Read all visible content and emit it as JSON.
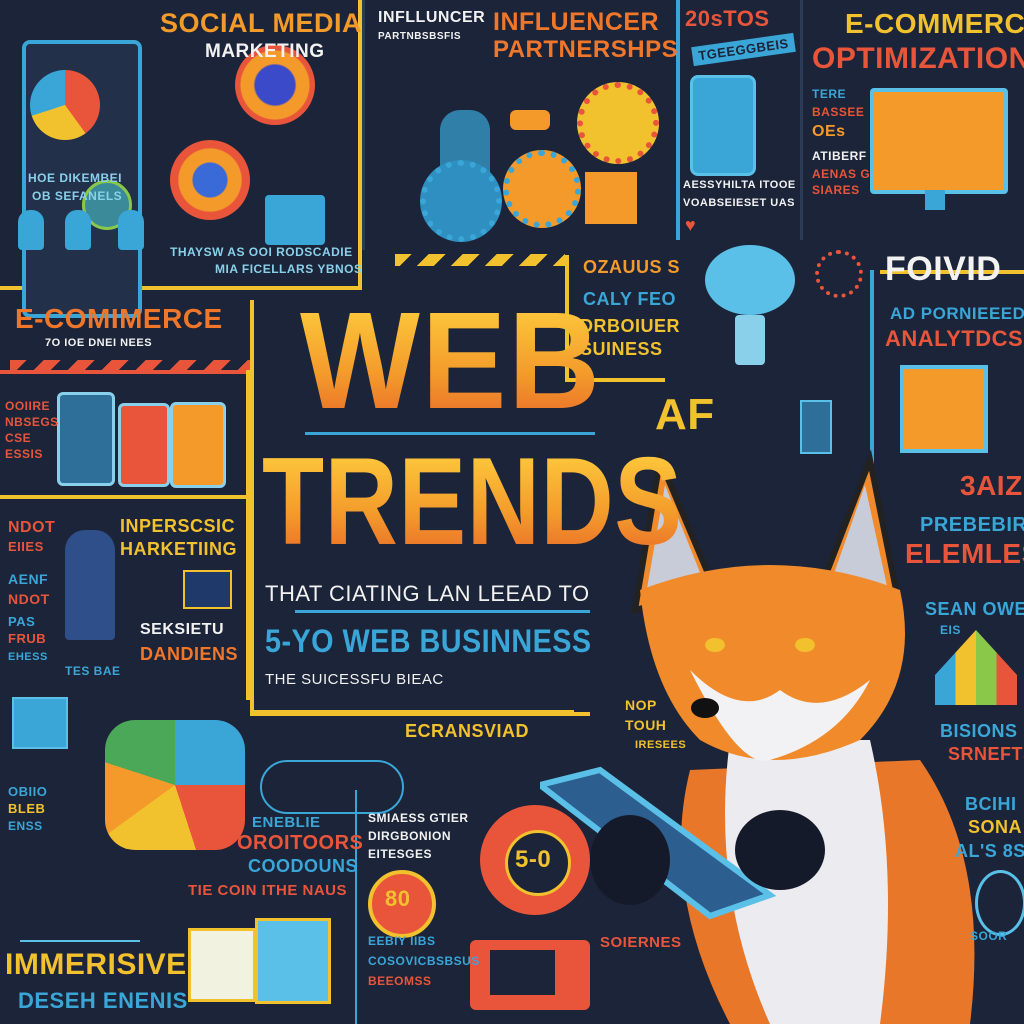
{
  "colors": {
    "background": "#1b2438",
    "yellow": "#f2c12e",
    "orange": "#f39a2b",
    "red": "#e8553a",
    "cyan": "#3aa6d8",
    "white": "#f2f2f2"
  },
  "social": {
    "title": "SOCIAL MEDIA",
    "subtitle": "MARKETING",
    "note1": "HOE DIKEMBEI",
    "note2": "OB SEFANELS",
    "caption1": "THAYSW AS OOI RODSCADIE",
    "caption2": "MIA FICELLARS YBNOS"
  },
  "influencer": {
    "small_title": "INFLLUNCER",
    "small_sub": "PARTNBSBSFIS",
    "title": "INFLUENCER",
    "subtitle": "PARTNERSHPS"
  },
  "stats": {
    "title": "20sTOS",
    "banner": "TGEEGGBEIS",
    "line1": "AESSYHILTA ITOOE",
    "line2": "VOABSEIESET UAS"
  },
  "ecom_opt": {
    "title1": "E-COMMERCE",
    "title2": "OPTIMIZATION",
    "side": [
      "TERE",
      "BASSEE",
      "OEs",
      "ATIBERF",
      "AENAS G",
      "SIARES"
    ]
  },
  "middle_right": {
    "t1": "OZAUUS S",
    "t2": "CALY FEO",
    "t3": "DRBOIUER",
    "t4": "SUINESS"
  },
  "analytics": {
    "title": "FOIVID",
    "sub": "AD PORNIEEED",
    "title2": "ANALYTDCSS"
  },
  "ecom_left": {
    "title": "E-COMIMERCE",
    "sub": "7O IOE DNEI NEES",
    "side": [
      "OOIIRE",
      "NBSEGS",
      "CSE",
      "ESSIS"
    ]
  },
  "hero": {
    "word1": "WEB",
    "word2": "TRENDS",
    "tagline": "THAT CIATING LAN LEEAD TO",
    "headline": "5-YO WEB BUSINNESS",
    "footer": "THE SUICESSFU BIEAC"
  },
  "ai_badge": "AF",
  "right_col": {
    "t1": "3AIZ",
    "t2": "PREBEBIR",
    "t3": "ELEMLES",
    "t4": "SEAN OWET",
    "t5": "EIS",
    "t6": "BISIONS",
    "t7": "SRNEFTS",
    "t8": "BCIHI",
    "t9": "SONA",
    "t10": "AL'S 8S",
    "t11": "SOOR"
  },
  "left_col": {
    "side": [
      "NDOT",
      "EIIES",
      "AENF",
      "NDOT",
      "PAS",
      "FRUB",
      "EHESS"
    ],
    "title1": "INPERSCSIC",
    "title2": "HARKETIING",
    "t3": "SEKSIETU",
    "t4": "DANDIENS",
    "t5": "TES BAE",
    "side2": [
      "OBIIO",
      "BLEB",
      "ENSS"
    ]
  },
  "bottom": {
    "ecransviad": "ECRANSVIAD",
    "nop": [
      "NOP",
      "TOUH",
      "IRESEES"
    ],
    "enablie": "ENEBLIE",
    "oroitoors": "OROITOORS",
    "coodouns": "COODOUNS",
    "smiaess": [
      "SMIAESS GTIER",
      "DIRGBONION",
      "EITESGES"
    ],
    "tie": "TIE COIN ITHE NAUS",
    "badge_center": "5-0",
    "badge_80": "80",
    "immersive": "IMMERISIVE",
    "desh": "DESEH ENENIS",
    "eebiy": [
      "EEBIY IIBS",
      "COSOVICBSBSUS",
      "BEEOMSS"
    ],
    "soiernes": "SOIERNES"
  },
  "icons": [
    "phone-icon",
    "gear-icon",
    "lightbulb-icon",
    "cloud-icon",
    "monitor-icon",
    "tablet-icon",
    "chart-icon",
    "person-icon",
    "truck-icon",
    "laptop-icon",
    "heart-icon",
    "envelope-icon",
    "fox-illustration"
  ]
}
